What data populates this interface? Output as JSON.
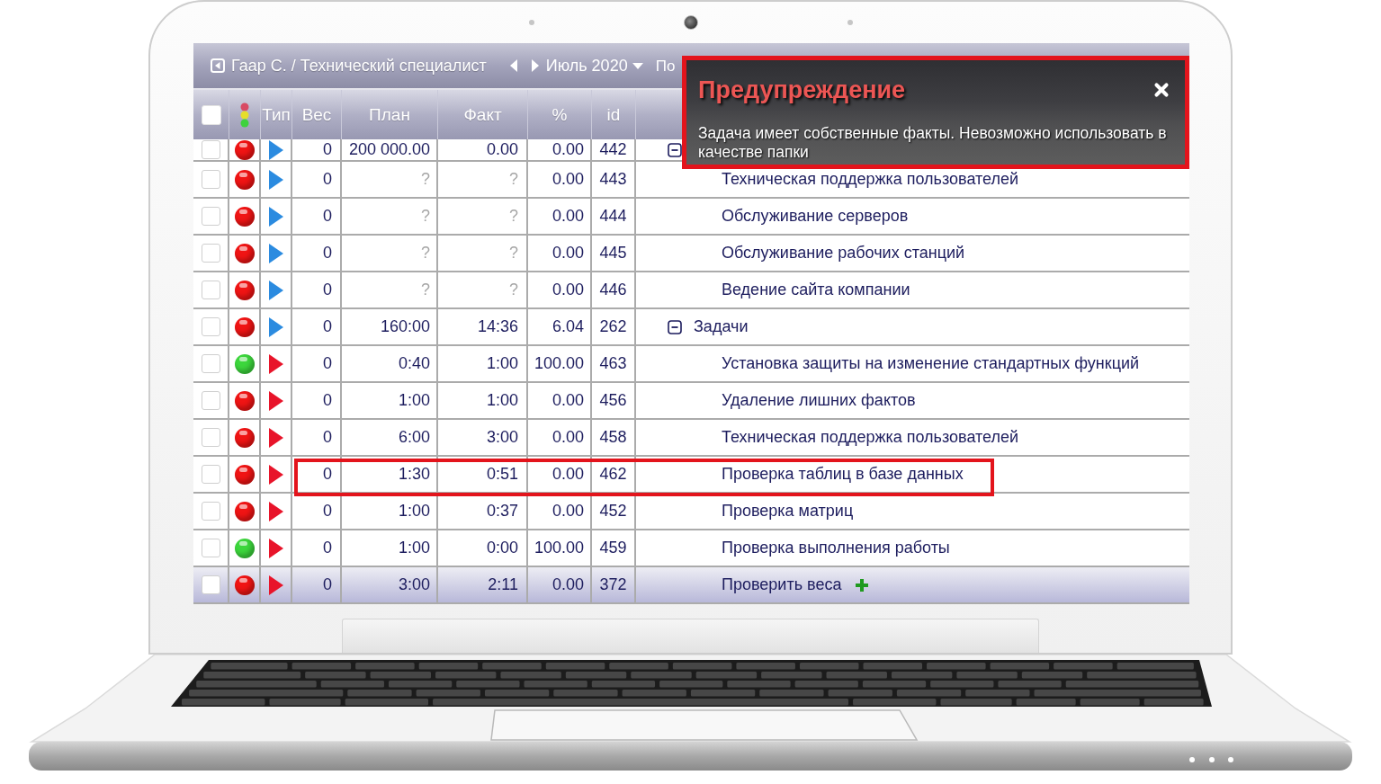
{
  "app_bar": {
    "breadcrumb": "Гаар С. / Технический специалист",
    "period": "Июль 2020",
    "menu": [
      "По"
    ]
  },
  "table": {
    "select_all_checked": false,
    "columns": [
      "Тип",
      "Вес",
      "План",
      "Факт",
      "%",
      "id"
    ],
    "rows": [
      {
        "checked": false,
        "selected": false,
        "highlighted": false,
        "unset": false,
        "status": {
          "color": "#f01414"
        },
        "type": {
          "color": "#2b8be0"
        },
        "weight": "0",
        "plan": "200 000.00",
        "fact": "0.00",
        "percent": "0.00",
        "id": "442",
        "expanded": true,
        "children": [
          {
            "checked": false,
            "selected": false,
            "highlighted": false,
            "unset": true,
            "status": {
              "color": "#f01414"
            },
            "type": {
              "color": "#2b8be0"
            },
            "weight": "0",
            "plan": "?",
            "fact": "?",
            "percent": "0.00",
            "id": "443",
            "name": "Техническая поддержка пользователей"
          },
          {
            "checked": false,
            "selected": false,
            "highlighted": false,
            "unset": true,
            "status": {
              "color": "#f01414"
            },
            "type": {
              "color": "#2b8be0"
            },
            "weight": "0",
            "plan": "?",
            "fact": "?",
            "percent": "0.00",
            "id": "444",
            "name": "Обслуживание серверов"
          },
          {
            "checked": false,
            "selected": false,
            "highlighted": false,
            "unset": true,
            "status": {
              "color": "#f01414"
            },
            "type": {
              "color": "#2b8be0"
            },
            "weight": "0",
            "plan": "?",
            "fact": "?",
            "percent": "0.00",
            "id": "445",
            "name": "Обслуживание рабочих станций"
          },
          {
            "checked": false,
            "selected": false,
            "highlighted": false,
            "unset": true,
            "status": {
              "color": "#f01414"
            },
            "type": {
              "color": "#2b8be0"
            },
            "weight": "0",
            "plan": "?",
            "fact": "?",
            "percent": "0.00",
            "id": "446",
            "name": "Ведение сайта компании"
          }
        ]
      },
      {
        "checked": false,
        "selected": false,
        "highlighted": false,
        "unset": false,
        "status": {
          "color": "#f01414"
        },
        "type": {
          "color": "#2b8be0"
        },
        "weight": "0",
        "plan": "160:00",
        "fact": "14:36",
        "percent": "6.04",
        "id": "262",
        "name": "Задачи",
        "expanded": true,
        "children": [
          {
            "checked": false,
            "selected": false,
            "highlighted": false,
            "unset": false,
            "status": {
              "color": "#3cd63c"
            },
            "type": {
              "color": "#e8142a"
            },
            "weight": "0",
            "plan": "0:40",
            "fact": "1:00",
            "percent": "100.00",
            "id": "463",
            "name": "Установка защиты на изменение стандартных функций"
          },
          {
            "checked": false,
            "selected": false,
            "highlighted": false,
            "unset": false,
            "status": {
              "color": "#f01414"
            },
            "type": {
              "color": "#e8142a"
            },
            "weight": "0",
            "plan": "1:00",
            "fact": "1:00",
            "percent": "0.00",
            "id": "456",
            "name": "Удаление лишних фактов"
          },
          {
            "checked": false,
            "selected": false,
            "highlighted": false,
            "unset": false,
            "status": {
              "color": "#f01414"
            },
            "type": {
              "color": "#e8142a"
            },
            "weight": "0",
            "plan": "6:00",
            "fact": "3:00",
            "percent": "0.00",
            "id": "458",
            "name": "Техническая поддержка пользователей"
          },
          {
            "checked": false,
            "selected": false,
            "highlighted": true,
            "unset": false,
            "status": {
              "color": "#f01414"
            },
            "type": {
              "color": "#e8142a"
            },
            "weight": "0",
            "plan": "1:30",
            "fact": "0:51",
            "percent": "0.00",
            "id": "462",
            "name": "Проверка таблиц в базе данных"
          },
          {
            "checked": false,
            "selected": false,
            "highlighted": false,
            "unset": false,
            "status": {
              "color": "#f01414"
            },
            "type": {
              "color": "#e8142a"
            },
            "weight": "0",
            "plan": "1:00",
            "fact": "0:37",
            "percent": "0.00",
            "id": "452",
            "name": "Проверка матриц"
          },
          {
            "checked": false,
            "selected": false,
            "highlighted": false,
            "unset": false,
            "status": {
              "color": "#3cd63c"
            },
            "type": {
              "color": "#e8142a"
            },
            "weight": "0",
            "plan": "1:00",
            "fact": "0:00",
            "percent": "100.00",
            "id": "459",
            "name": "Проверка выполнения работы"
          },
          {
            "checked": false,
            "selected": true,
            "highlighted": false,
            "unset": false,
            "status": {
              "color": "#f01414"
            },
            "type": {
              "color": "#e8142a"
            },
            "weight": "0",
            "plan": "3:00",
            "fact": "2:11",
            "percent": "0.00",
            "id": "372",
            "name": "Проверить веса"
          }
        ]
      }
    ]
  },
  "warning_dialog": {
    "title": "Предупреждение",
    "message": "Задача имеет собственные факты. Невозможно использовать в качестве папки",
    "highlighted": true
  }
}
